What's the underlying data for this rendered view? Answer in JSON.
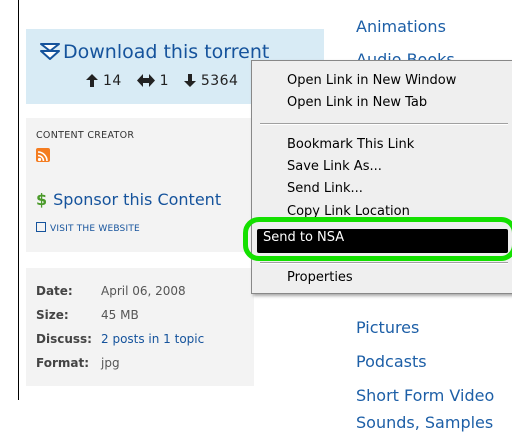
{
  "download": {
    "link_text": "Download this torrent",
    "icon": "download-arrow-icon",
    "seeders": "14",
    "ratio": "1",
    "downloads": "5364"
  },
  "creator": {
    "section_label": "CONTENT CREATOR",
    "rss_icon": "rss-icon",
    "sponsor_text": "Sponsor this Content",
    "visit_text": "VISIT THE WEBSITE"
  },
  "details": {
    "date_label": "Date:",
    "date_value": "April 06, 2008",
    "size_label": "Size:",
    "size_value": "45 MB",
    "discuss_label": "Discuss:",
    "discuss_value": "2 posts in 1 topic",
    "format_label": "Format:",
    "format_value": "jpg"
  },
  "right_links": [
    "Animations",
    "Audio Books",
    "Pictures",
    "Podcasts",
    "Short Form Video",
    "Sounds, Samples"
  ],
  "context_menu": {
    "items": [
      "Open Link in New Window",
      "Open Link in New Tab",
      "Bookmark This Link",
      "Save Link As...",
      "Send Link...",
      "Copy Link Location",
      "Send to NSA",
      "Properties"
    ],
    "highlighted": "Send to NSA",
    "highlight_ring_color": "#14e000"
  },
  "colors": {
    "link": "#15539c",
    "download_box_bg": "#d8ebf5",
    "panel_bg": "#f3f3f3"
  }
}
